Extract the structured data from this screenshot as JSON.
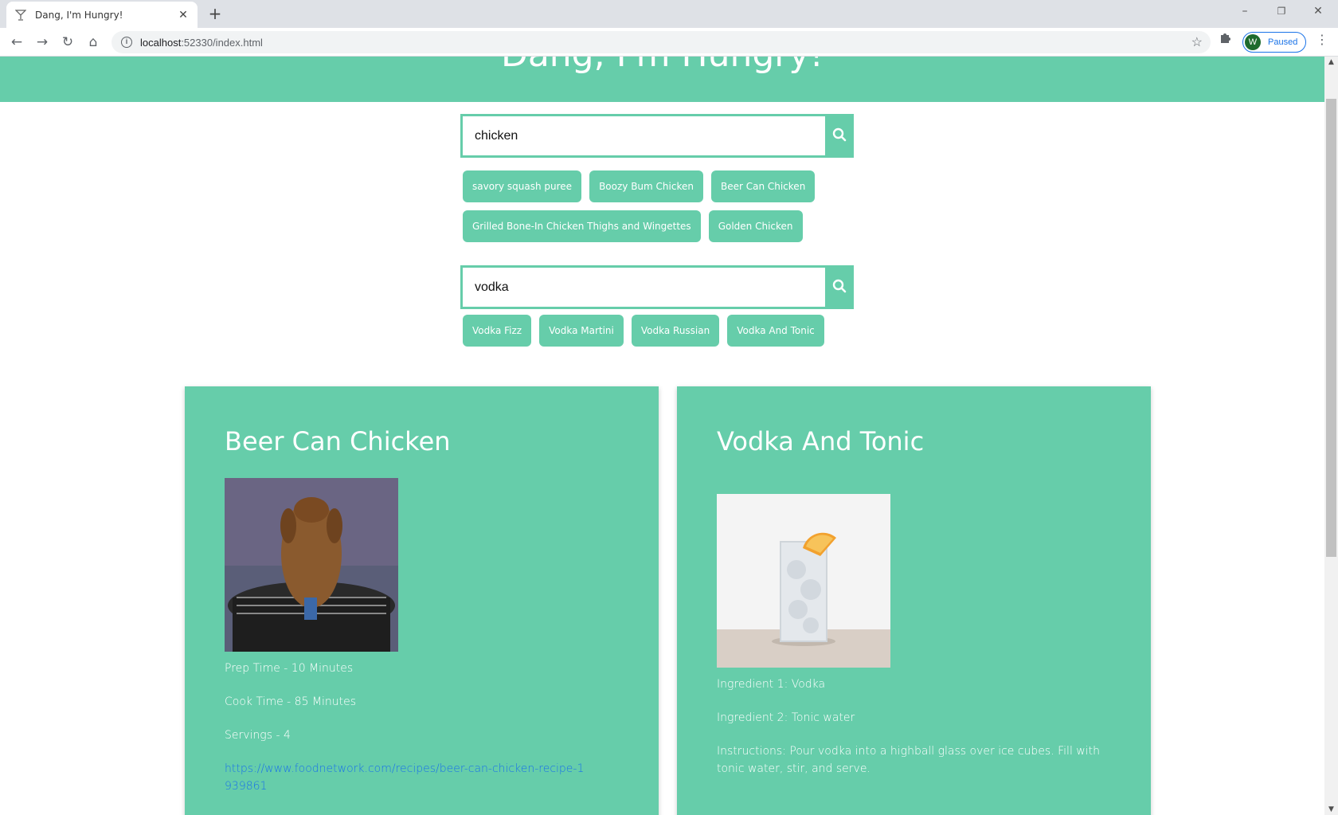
{
  "browser": {
    "tab_title": "Dang, I'm Hungry!",
    "url_host": "localhost",
    "url_rest": ":52330/index.html",
    "profile_initial": "W",
    "profile_status": "Paused"
  },
  "header": {
    "title": "Dang, I'm Hungry!"
  },
  "food_search": {
    "value": "chicken",
    "suggestions": [
      "savory squash puree",
      "Boozy Bum Chicken",
      "Beer Can Chicken",
      "Grilled Bone-In Chicken Thighs and Wingettes",
      "Golden Chicken"
    ]
  },
  "drink_search": {
    "value": "vodka",
    "suggestions": [
      "Vodka Fizz",
      "Vodka Martini",
      "Vodka Russian",
      "Vodka And Tonic"
    ]
  },
  "food_card": {
    "title": "Beer Can Chicken",
    "prep": "Prep Time - 10 Minutes",
    "cook": "Cook Time - 85 Minutes",
    "servings": "Servings - 4",
    "link": "https://www.foodnetwork.com/recipes/beer-can-chicken-recipe-1939861"
  },
  "drink_card": {
    "title": "Vodka And Tonic",
    "ingredient1": "Ingredient 1: Vodka",
    "ingredient2": "Ingredient 2: Tonic water",
    "instructions": "Instructions: Pour vodka into a highball glass over ice cubes. Fill with tonic water, stir, and serve."
  },
  "colors": {
    "accent": "#66cdaa",
    "link": "#1a73e8"
  }
}
